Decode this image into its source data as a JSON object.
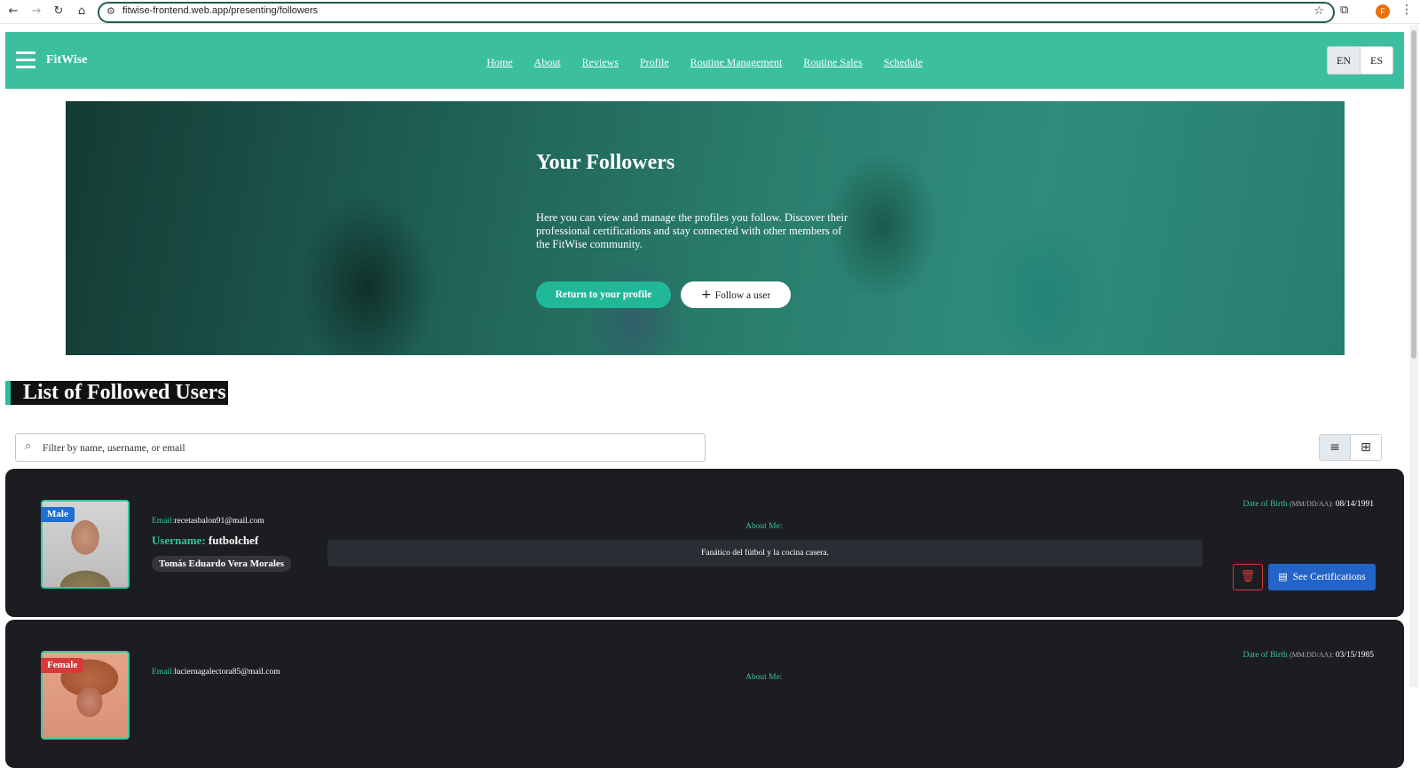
{
  "browser": {
    "url": "fitwise-frontend.web.app/presenting/followers",
    "profile_initial": "F",
    "icons": [
      "back-icon",
      "forward-icon",
      "reload-icon",
      "home-icon",
      "tune-icon",
      "star-icon",
      "extensions-icon",
      "kebab-icon"
    ]
  },
  "header": {
    "brand": "FitWise",
    "nav": [
      "Home",
      "About",
      "Reviews",
      "Profile",
      "Routine Management",
      "Routine Sales",
      "Schedule"
    ],
    "lang": {
      "en": "EN",
      "es": "ES",
      "active": "EN"
    },
    "accent": "#3bbf9f"
  },
  "hero": {
    "title": "Your Followers",
    "description": "Here you can view and manage the profiles you follow. Discover their professional certifications and stay connected with other members of the FitWise community.",
    "primary_button": "Return to your profile",
    "secondary_button": "Follow a user"
  },
  "section": {
    "title": "List of Followed Users"
  },
  "filter": {
    "placeholder": "Filter by name, username, or email",
    "value": "",
    "view_mode": "list"
  },
  "users": [
    {
      "gender": "Male",
      "email_label": "Email:",
      "email": "recetasbalon91@mail.com",
      "username_label": "Username:",
      "username": "futbolchef",
      "full_name": "Tomás Eduardo Vera Morales",
      "about_label": "About Me:",
      "about": "Fanático del fútbol y la cocina casera.",
      "dob_label": "Date of Birth",
      "dob_format": "(MM/DD/AA):",
      "dob": "08/14/1991",
      "cert_button": "See Certifications"
    },
    {
      "gender": "Female",
      "email_label": "Email:",
      "email": "luciernagalectora85@mail.com",
      "about_label": "About Me:",
      "dob_label": "Date of Birth",
      "dob_format": "(MM/DD/AA):",
      "dob": "03/15/1985"
    }
  ],
  "colors": {
    "card_bg": "#1c1d21",
    "teal_text": "#35c4a1",
    "male_badge": "#1e6fd1",
    "female_badge": "#d83a3a",
    "cert_button": "#2463c7"
  }
}
